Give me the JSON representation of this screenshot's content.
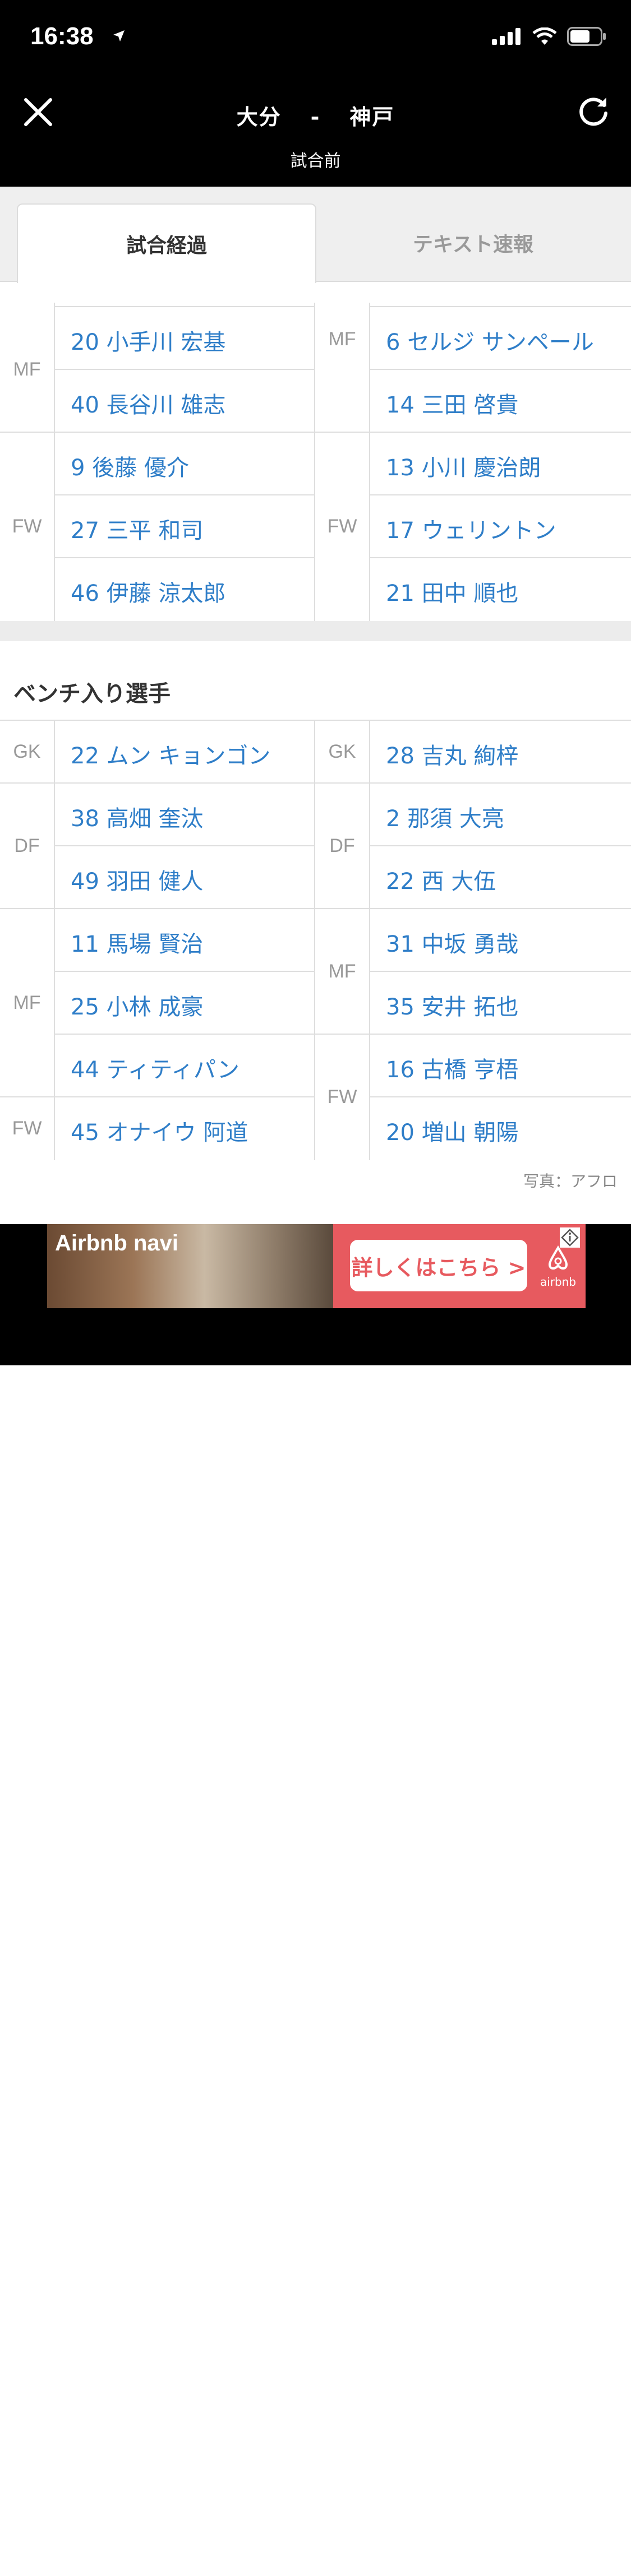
{
  "status_bar": {
    "time": "16:38"
  },
  "header": {
    "home_team": "大分",
    "separator": "-",
    "away_team": "神戸",
    "status": "試合前"
  },
  "tabs": [
    {
      "label": "試合経過",
      "active": true
    },
    {
      "label": "テキスト速報",
      "active": false
    }
  ],
  "starters": {
    "left": [
      {
        "pos": "MF",
        "players": [
          "20 小手川 宏基",
          "40 長谷川 雄志"
        ]
      },
      {
        "pos": "FW",
        "players": [
          "9 後藤 優介",
          "27 三平 和司",
          "46 伊藤 涼太郎"
        ]
      }
    ],
    "right": [
      {
        "pos": "MF",
        "players": [
          "6 セルジ サンペール",
          "14 三田 啓貴"
        ]
      },
      {
        "pos": "FW",
        "players": [
          "13 小川 慶治朗",
          "17 ウェリントン",
          "21 田中 順也"
        ]
      }
    ]
  },
  "bench": {
    "title": "ベンチ入り選手",
    "left": [
      {
        "pos": "GK",
        "players": [
          "22 ムン キョンゴン"
        ]
      },
      {
        "pos": "DF",
        "players": [
          "38 高畑 奎汰",
          "49 羽田 健人"
        ]
      },
      {
        "pos": "MF",
        "players": [
          "11 馬場 賢治",
          "25 小林 成豪",
          "44 ティティパン"
        ]
      },
      {
        "pos": "FW",
        "players": [
          "45 オナイウ 阿道"
        ]
      }
    ],
    "right": [
      {
        "pos": "GK",
        "players": [
          "28 吉丸 絢梓"
        ]
      },
      {
        "pos": "DF",
        "players": [
          "2 那須 大亮",
          "22 西 大伍"
        ]
      },
      {
        "pos": "MF",
        "players": [
          "31 中坂 勇哉",
          "35 安井 拓也"
        ]
      },
      {
        "pos": "FW",
        "players": [
          "16 古橋 亨梧",
          "20 増山 朝陽"
        ]
      }
    ]
  },
  "photo_credit": "写真：アフロ",
  "ad": {
    "brand": "Airbnb navi",
    "cta": "詳しくはこちら >",
    "logo_text": "airbnb"
  },
  "colors": {
    "link": "#2f7ec8",
    "ad_bg": "#e75a5f"
  }
}
